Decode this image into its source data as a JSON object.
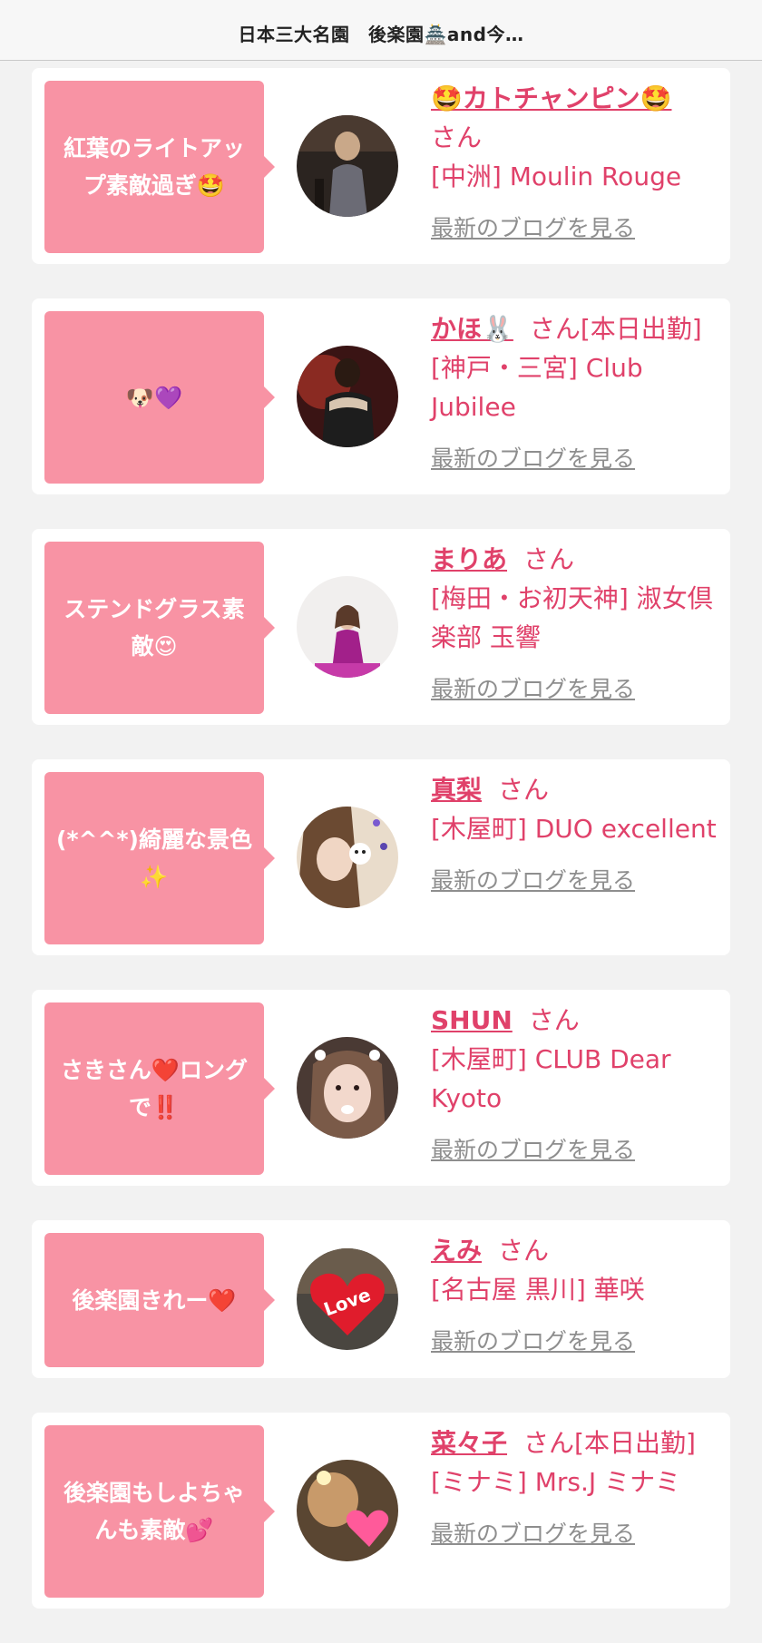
{
  "header": {
    "title": "日本三大名園　後楽園🏯and今…"
  },
  "cards": [
    {
      "bubble": "紅葉のライトアップ素敵過ぎ🤩",
      "name": "🤩カトチャンピン🤩",
      "honorific": "さん",
      "shop": "[中洲] Moulin Rouge",
      "more": "最新のブログを見る"
    },
    {
      "bubble": "🐶💜",
      "name": "かほ🐰",
      "honorific": "さん[本日出勤]",
      "shop": "[神戸・三宮] Club Jubilee",
      "more": "最新のブログを見る"
    },
    {
      "bubble": "ステンドグラス素敵😍",
      "name": "まりあ",
      "honorific": "さん",
      "shop": "[梅田・お初天神] 淑女倶楽部 玉響",
      "more": "最新のブログを見る"
    },
    {
      "bubble": "(*^^*)綺麗な景色✨",
      "name": "真梨",
      "honorific": "さん",
      "shop": "[木屋町] DUO excellent",
      "more": "最新のブログを見る"
    },
    {
      "bubble": "さきさん❤️ロングで‼️",
      "name": "SHUN",
      "honorific": "さん",
      "shop": "[木屋町] CLUB Dear Kyoto",
      "more": "最新のブログを見る"
    },
    {
      "bubble": "後楽園きれー❤️",
      "name": "えみ",
      "honorific": "さん",
      "shop": "[名古屋 黒川] 華咲",
      "more": "最新のブログを見る"
    },
    {
      "bubble": "後楽園もしよちゃんも素敵💕",
      "name": "菜々子",
      "honorific": "さん[本日出勤]",
      "shop": "[ミナミ] Mrs.J ミナミ",
      "more": "最新のブログを見る"
    }
  ]
}
